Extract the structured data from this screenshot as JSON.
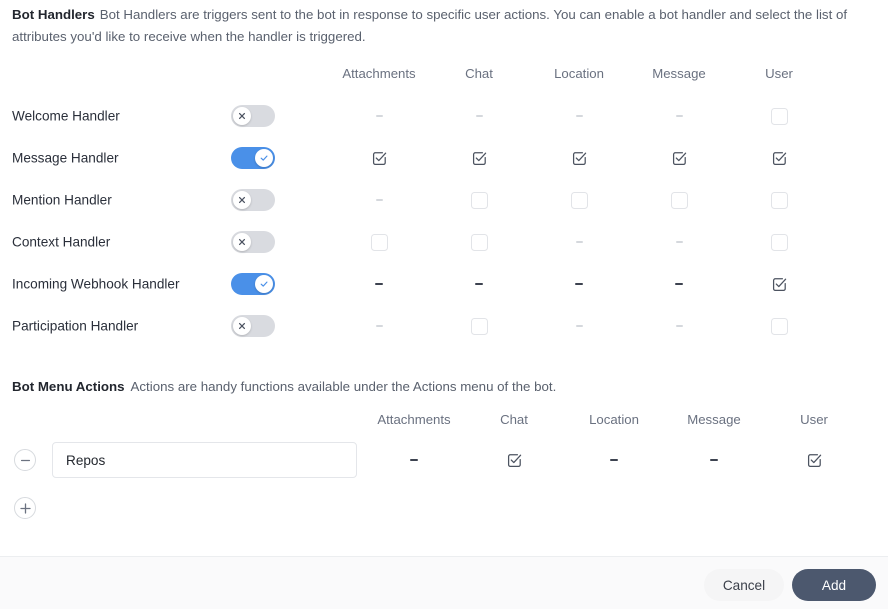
{
  "handlers_section": {
    "title": "Bot Handlers",
    "description": "Bot Handlers are triggers sent to the bot in response to specific user actions. You can enable a bot handler and select the list of attributes you'd like to receive when the handler is triggered.",
    "columns": [
      "Attachments",
      "Chat",
      "Location",
      "Message",
      "User"
    ],
    "rows": [
      {
        "label": "Welcome Handler",
        "enabled": false,
        "cells": [
          "dash",
          "dash",
          "dash",
          "dash",
          "unchecked"
        ]
      },
      {
        "label": "Message Handler",
        "enabled": true,
        "cells": [
          "checked",
          "checked",
          "checked",
          "checked",
          "checked"
        ]
      },
      {
        "label": "Mention Handler",
        "enabled": false,
        "cells": [
          "dash",
          "unchecked",
          "unchecked",
          "unchecked",
          "unchecked"
        ]
      },
      {
        "label": "Context Handler",
        "enabled": false,
        "cells": [
          "unchecked",
          "unchecked",
          "dash",
          "dash",
          "unchecked"
        ]
      },
      {
        "label": "Incoming Webhook Handler",
        "enabled": true,
        "cells": [
          "dash-dark",
          "dash-dark",
          "dash-dark",
          "dash-dark",
          "checked"
        ]
      },
      {
        "label": "Participation Handler",
        "enabled": false,
        "cells": [
          "dash",
          "unchecked",
          "dash",
          "dash",
          "unchecked"
        ]
      }
    ]
  },
  "actions_section": {
    "title": "Bot Menu Actions",
    "description": "Actions are handy functions available under the Actions menu of the bot.",
    "columns": [
      "Attachments",
      "Chat",
      "Location",
      "Message",
      "User"
    ],
    "rows": [
      {
        "value": "Repos",
        "placeholder": "",
        "cells": [
          "dash-dark",
          "checked",
          "dash-dark",
          "dash-dark",
          "checked"
        ]
      }
    ],
    "remove_icon": "minus-icon",
    "add_icon": "plus-icon"
  },
  "footer": {
    "cancel_label": "Cancel",
    "add_label": "Add"
  },
  "colors": {
    "toggle_on": "#4a90e8",
    "toggle_off": "#d9dbe0",
    "primary_button": "#4c586e",
    "text": "#2a2f3a",
    "muted": "#6a7180"
  }
}
